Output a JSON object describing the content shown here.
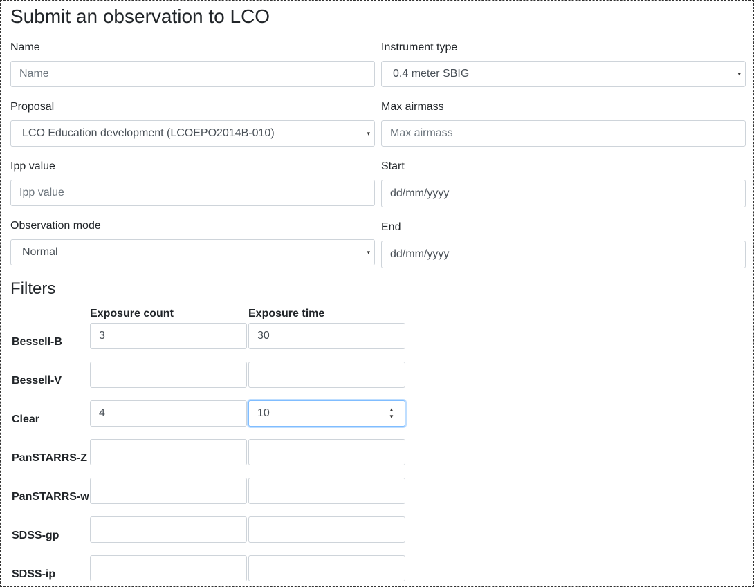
{
  "form": {
    "title": "Submit an observation to LCO",
    "name": {
      "label": "Name",
      "placeholder": "Name",
      "value": ""
    },
    "instrument_type": {
      "label": "Instrument type",
      "selected": "0.4 meter SBIG"
    },
    "proposal": {
      "label": "Proposal",
      "selected": "LCO Education development (LCOEPO2014B-010)"
    },
    "max_airmass": {
      "label": "Max airmass",
      "placeholder": "Max airmass",
      "value": ""
    },
    "ipp_value": {
      "label": "Ipp value",
      "placeholder": "Ipp value",
      "value": ""
    },
    "start": {
      "label": "Start",
      "value": "dd/mm/yyyy"
    },
    "observation_mode": {
      "label": "Observation mode",
      "selected": "Normal"
    },
    "end": {
      "label": "End",
      "value": "dd/mm/yyyy"
    }
  },
  "filters": {
    "title": "Filters",
    "col_count": "Exposure count",
    "col_time": "Exposure time",
    "rows": [
      {
        "name": "Bessell-B",
        "count": "3",
        "time": "30"
      },
      {
        "name": "Bessell-V",
        "count": "",
        "time": ""
      },
      {
        "name": "Clear",
        "count": "4",
        "time": "10"
      },
      {
        "name": "PanSTARRS-Z",
        "count": "",
        "time": ""
      },
      {
        "name": "PanSTARRS-w",
        "count": "",
        "time": ""
      },
      {
        "name": "SDSS-gp",
        "count": "",
        "time": ""
      },
      {
        "name": "SDSS-ip",
        "count": "",
        "time": ""
      }
    ]
  },
  "icons": {
    "caret": "▾",
    "spin_up": "▲",
    "spin_down": "▼"
  },
  "colors": {
    "focus_border": "#80bdff",
    "input_border": "#ced4da",
    "placeholder": "#6c757d"
  }
}
